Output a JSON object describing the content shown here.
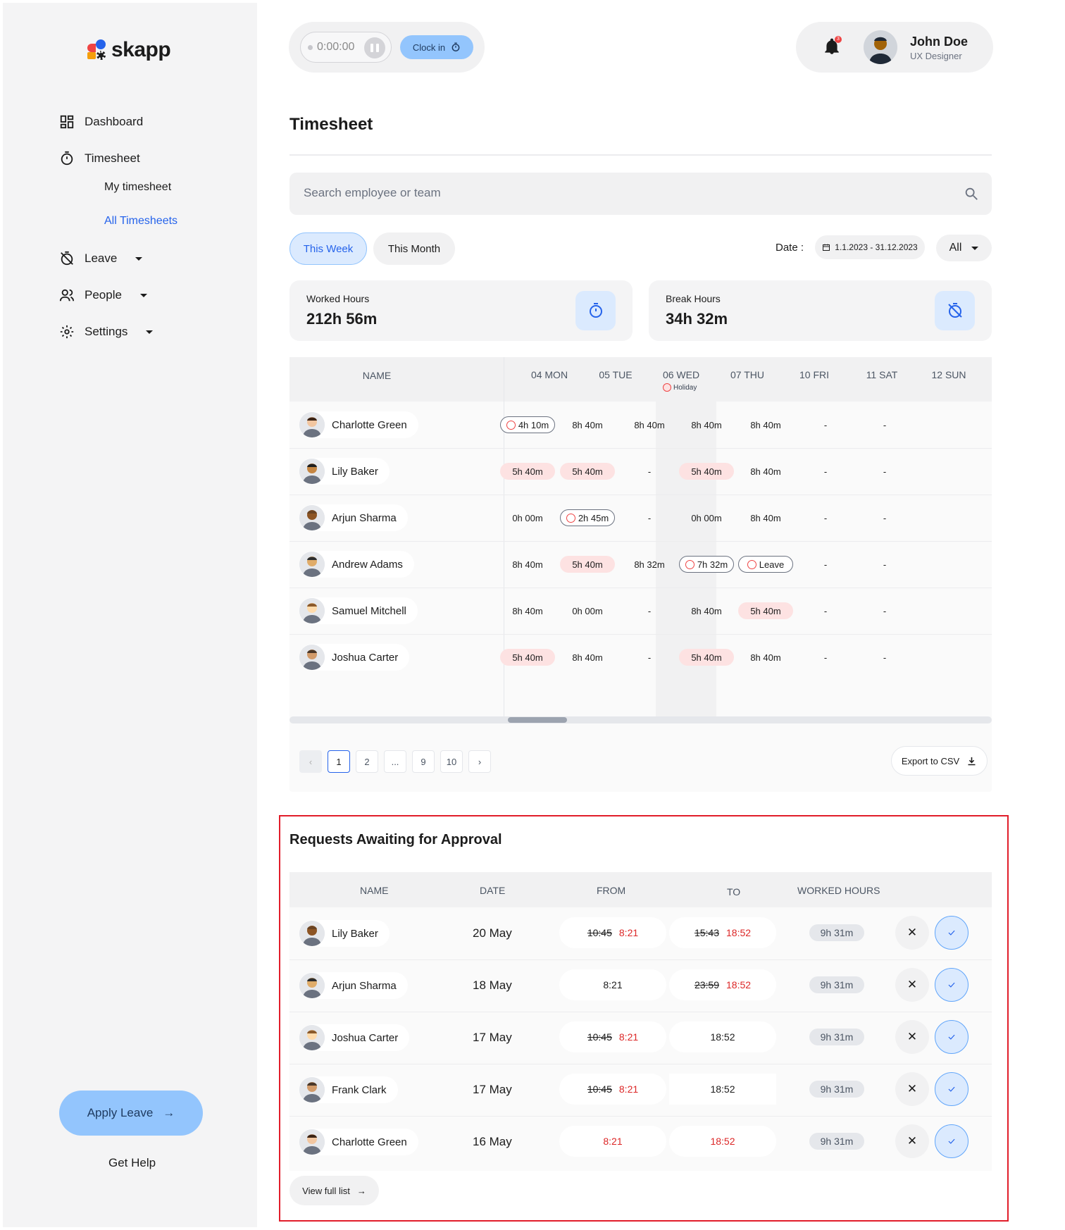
{
  "brand": {
    "name": "skapp"
  },
  "sidebar": {
    "items": [
      {
        "label": "Dashboard",
        "icon": "dashboard-icon"
      },
      {
        "label": "Timesheet",
        "icon": "stopwatch-icon"
      },
      {
        "label": "Leave",
        "icon": "timer-off-icon"
      },
      {
        "label": "People",
        "icon": "people-icon"
      },
      {
        "label": "Settings",
        "icon": "gear-icon"
      }
    ],
    "sub_items": [
      {
        "label": "My timesheet",
        "active": false
      },
      {
        "label": "All Timesheets",
        "active": true
      }
    ],
    "apply_leave": "Apply Leave",
    "get_help": "Get Help"
  },
  "topbar": {
    "timer": "0:00:00",
    "clock_in": "Clock in",
    "notifications": "3",
    "user_name": "John Doe",
    "user_role": "UX Designer"
  },
  "page": {
    "title": "Timesheet",
    "search_placeholder": "Search employee or team",
    "tabs": [
      {
        "label": "This Week",
        "active": true
      },
      {
        "label": "This Month",
        "active": false
      }
    ],
    "date_label": "Date :",
    "date_range": "1.1.2023 - 31.12.2023",
    "filter_value": "All"
  },
  "stats": [
    {
      "label": "Worked Hours",
      "value": "212h 56m",
      "icon": "stopwatch-icon"
    },
    {
      "label": "Break Hours",
      "value": "34h 32m",
      "icon": "timer-off-icon"
    }
  ],
  "timesheet": {
    "name_header": "NAME",
    "days": [
      "04 MON",
      "05 TUE",
      "06 WED",
      "07 THU",
      "10 FRI",
      "11 SAT",
      "12 SUN"
    ],
    "holiday_label": "Holiday",
    "rows": [
      {
        "name": "Charlotte Green",
        "cells": [
          {
            "v": "4h 10m",
            "s": "out",
            "icon": "palm-icon"
          },
          {
            "v": "8h 40m"
          },
          {
            "v": "8h 40m"
          },
          {
            "v": "8h 40m"
          },
          {
            "v": "8h 40m"
          },
          {
            "v": "-"
          },
          {
            "v": "-"
          }
        ]
      },
      {
        "name": "Lily Baker",
        "cells": [
          {
            "v": "5h 40m",
            "s": "red"
          },
          {
            "v": "5h 40m",
            "s": "red"
          },
          {
            "v": "-"
          },
          {
            "v": "5h 40m",
            "s": "red"
          },
          {
            "v": "8h 40m"
          },
          {
            "v": "-"
          },
          {
            "v": "-"
          }
        ]
      },
      {
        "name": "Arjun Sharma",
        "cells": [
          {
            "v": "0h 00m"
          },
          {
            "v": "2h 45m",
            "s": "out",
            "icon": "sick-icon"
          },
          {
            "v": "-"
          },
          {
            "v": "0h 00m"
          },
          {
            "v": "8h 40m"
          },
          {
            "v": "-"
          },
          {
            "v": "-"
          }
        ]
      },
      {
        "name": "Andrew Adams",
        "cells": [
          {
            "v": "8h 40m"
          },
          {
            "v": "5h 40m",
            "s": "red"
          },
          {
            "v": "8h 32m"
          },
          {
            "v": "7h 32m",
            "s": "out",
            "icon": "calendar-icon"
          },
          {
            "v": "Leave",
            "s": "out",
            "icon": "leave-icon"
          },
          {
            "v": "-"
          },
          {
            "v": "-"
          }
        ]
      },
      {
        "name": "Samuel Mitchell",
        "cells": [
          {
            "v": "8h 40m"
          },
          {
            "v": "0h 00m"
          },
          {
            "v": "-"
          },
          {
            "v": "8h 40m"
          },
          {
            "v": "5h 40m",
            "s": "red"
          },
          {
            "v": "-"
          },
          {
            "v": "-"
          }
        ]
      },
      {
        "name": "Joshua Carter",
        "cells": [
          {
            "v": "5h 40m",
            "s": "red"
          },
          {
            "v": "8h 40m"
          },
          {
            "v": "-"
          },
          {
            "v": "5h 40m",
            "s": "red"
          },
          {
            "v": "8h 40m"
          },
          {
            "v": "-"
          },
          {
            "v": "-"
          }
        ]
      }
    ],
    "pages": [
      "1",
      "2",
      "...",
      "9",
      "10"
    ],
    "current_page": "1",
    "export_label": "Export to CSV"
  },
  "requests": {
    "title": "Requests Awaiting for Approval",
    "headers": [
      "NAME",
      "DATE",
      "FROM",
      "TO",
      "WORKED HOURS"
    ],
    "rows": [
      {
        "name": "Lily Baker",
        "date": "20 May",
        "from_old": "10:45",
        "from_new": "8:21",
        "to_old": "15:43",
        "to_new": "18:52",
        "hours": "9h 31m"
      },
      {
        "name": "Arjun Sharma",
        "date": "18 May",
        "from_old": "",
        "from_new": "8:21",
        "to_old": "23:59",
        "to_new": "18:52",
        "hours": "9h 31m"
      },
      {
        "name": "Joshua Carter",
        "date": "17 May",
        "from_old": "10:45",
        "from_new": "8:21",
        "to_old": "",
        "to_new": "18:52",
        "hours": "9h 31m"
      },
      {
        "name": "Frank Clark",
        "date": "17 May",
        "from_old": "10:45",
        "from_new": "8:21",
        "to_old": "",
        "to_new": "18:52",
        "hours": "9h 31m"
      },
      {
        "name": "Charlotte Green",
        "date": "16 May",
        "from_old": "",
        "from_new": "8:21",
        "to_old": "",
        "to_new": "18:52",
        "hours": "9h 31m"
      }
    ],
    "view_full": "View full list"
  }
}
